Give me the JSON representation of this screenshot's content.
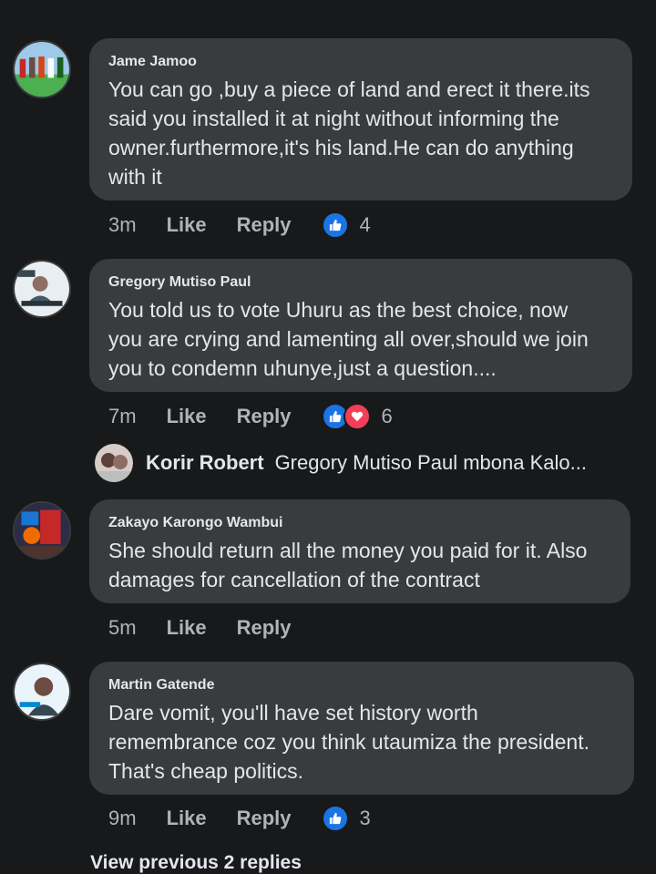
{
  "comments": [
    {
      "author": "Jame Jamoo",
      "text": "You can go ,buy a piece of land and erect it there.its\nsaid you installed it at night without informing the\nowner.furthermore,it's his land.He can do anything\nwith it",
      "time": "3m",
      "like_label": "Like",
      "reply_label": "Reply",
      "reactions": [
        "like-icon"
      ],
      "reaction_count": "4"
    },
    {
      "author": "Gregory Mutiso Paul",
      "text": "You told us to vote Uhuru as the best choice, now\nyou are crying and lamenting all over,should we join\nyou to condemn uhunye,just a question....",
      "time": "7m",
      "like_label": "Like",
      "reply_label": "Reply",
      "reactions": [
        "like-icon",
        "love-icon"
      ],
      "reaction_count": "6"
    },
    {
      "author": "Zakayo Karongo Wambui",
      "text": "She should return all the money you paid for it. Also\ndamages for cancellation of the contract",
      "time": "5m",
      "like_label": "Like",
      "reply_label": "Reply"
    },
    {
      "author": "Martin Gatende",
      "text": "Dare vomit, you'll have set history worth\nremembrance coz you think utaumiza the president.\nThat's cheap politics.",
      "time": "9m",
      "like_label": "Like",
      "reply_label": "Reply",
      "reactions": [
        "like-icon"
      ],
      "reaction_count": "3"
    }
  ],
  "reply_preview": {
    "author": "Korir Robert",
    "text": "Gregory Mutiso Paul mbona Kalo..."
  },
  "view_previous": "View previous 2 replies",
  "colors": {
    "background": "#18191b",
    "bubble": "#3a3b3c",
    "like_blue": "#1b74e4",
    "love_red": "#f33e58",
    "secondary_text": "#b0b3b8"
  }
}
